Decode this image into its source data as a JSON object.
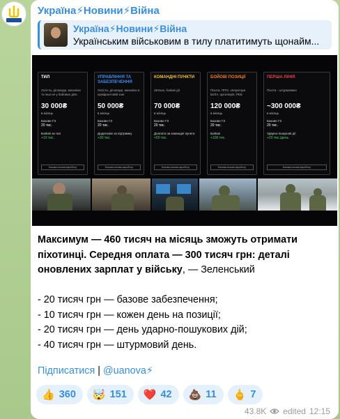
{
  "channel": {
    "name": "Україна⚡Новини⚡Війна"
  },
  "reply": {
    "title": "Україна⚡Новини⚡Війна",
    "text": "Українським військовим в тилу платитимуть щонайм..."
  },
  "infographic": {
    "cards": [
      {
        "cat": "Тил",
        "desc": "Логісти, діловоди, механіки та інші не у бойових діях",
        "amount": "30 000₴",
        "per": "в місяць",
        "row1": "Базове ГЗ",
        "val1": "20 тис.",
        "row2": "Бойові за тил",
        "bonus": "+10 тис.",
        "color": "#ffffff",
        "btn": "Базова основа заробітку"
      },
      {
        "cat": "Управління та забезпечення",
        "desc": "Логісти, діловоди, механіки в прифронтовій зоні",
        "amount": "50 000₴",
        "per": "в місяць",
        "row1": "Базове ГЗ",
        "val1": "20 тис.",
        "row2": "Додаткове за підтримку",
        "bonus": "+30 тис.",
        "color": "#3a8ef0",
        "btn": "Базова основа заробітку"
      },
      {
        "cat": "Командні пункти",
        "desc": "Зв'язок, бойові дії",
        "amount": "70 000₴",
        "per": "в місяць",
        "row1": "Базове ГЗ",
        "val1": "20 тис.",
        "row2": "Доплата за командні пункти",
        "bonus": "+50 тис.",
        "color": "#f2c23a",
        "btn": "Базова основа заробітку"
      },
      {
        "cat": "Бойові позиції",
        "desc": "Піхота, ППО, оператори БпЛА, артилерія, РЕБ",
        "amount": "120 000₴",
        "per": "в місяць",
        "row1": "Базове ГЗ",
        "val1": "20 тис.",
        "row2": "Бойові",
        "bonus": "+100 тис.",
        "color": "#f07a2a",
        "btn": "Базова основа заробітку"
      },
      {
        "cat": "Перша лінія",
        "desc": "Піхота · штурмовики",
        "amount": "~300 000₴",
        "per": "в місяць",
        "row1": "Базове ГЗ",
        "val1": "20 тис.",
        "row2": "Ударно-пошукові дії",
        "bonus": "+20 тис./день",
        "color": "#e9404a",
        "btn": "Базова основа заробітку"
      }
    ]
  },
  "post": {
    "bold_line": "Максимум — 460 тисяч на місяць зможуть отримати піхотинці. Середня оплата — 300 тисяч грн: деталі оновлених зарплат у війську",
    "tail": ", — Зеленський",
    "list": [
      "- 20 тисяч грн — базове забезпечення;",
      "- 10 тисяч грн — кожен день на позиції;",
      "- 20 тисяч грн — день ударно-пошукових дій;",
      "- 40 тисяч грн — штурмовий день."
    ],
    "subscribe": "Підписатися",
    "separator": "|",
    "handle": "@uanova⚡"
  },
  "reactions": [
    {
      "emoji": "👍",
      "count": "360",
      "icon": "thumbs-up-icon"
    },
    {
      "emoji": "🤯",
      "count": "151",
      "icon": "mind-blown-icon"
    },
    {
      "emoji": "❤️",
      "count": "42",
      "icon": "heart-icon"
    },
    {
      "emoji": "💩",
      "count": "11",
      "icon": "poop-icon"
    },
    {
      "emoji": "🖕",
      "count": "7",
      "icon": "middle-finger-icon"
    }
  ],
  "meta": {
    "views": "43.8K",
    "edited": "edited",
    "time": "12:15"
  }
}
